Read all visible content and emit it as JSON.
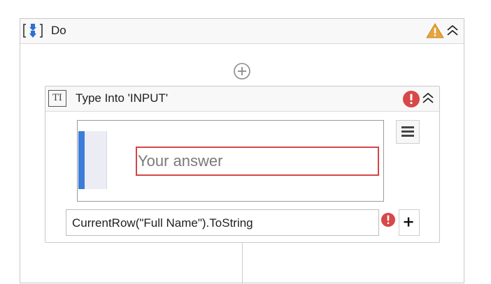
{
  "do_activity": {
    "title": "Do",
    "icons": {
      "sequence": "sequence-icon",
      "warning": "warning-icon",
      "collapse": "collapse-icon"
    }
  },
  "add_activity": {
    "icon": "plus-circle-icon"
  },
  "type_into": {
    "icon_text": "TI",
    "title": "Type Into 'INPUT'",
    "icons": {
      "error": "error-icon",
      "collapse": "collapse-icon",
      "menu": "hamburger-menu-icon",
      "add": "plus-icon"
    },
    "preview": {
      "placeholder": "Your answer"
    },
    "text_field": {
      "value": "CurrentRow(\"Full Name\").ToString"
    }
  },
  "colors": {
    "warning": "#e8a33d",
    "error": "#d84848",
    "accent": "#3b7dd8",
    "preview_border": "#d64545"
  }
}
